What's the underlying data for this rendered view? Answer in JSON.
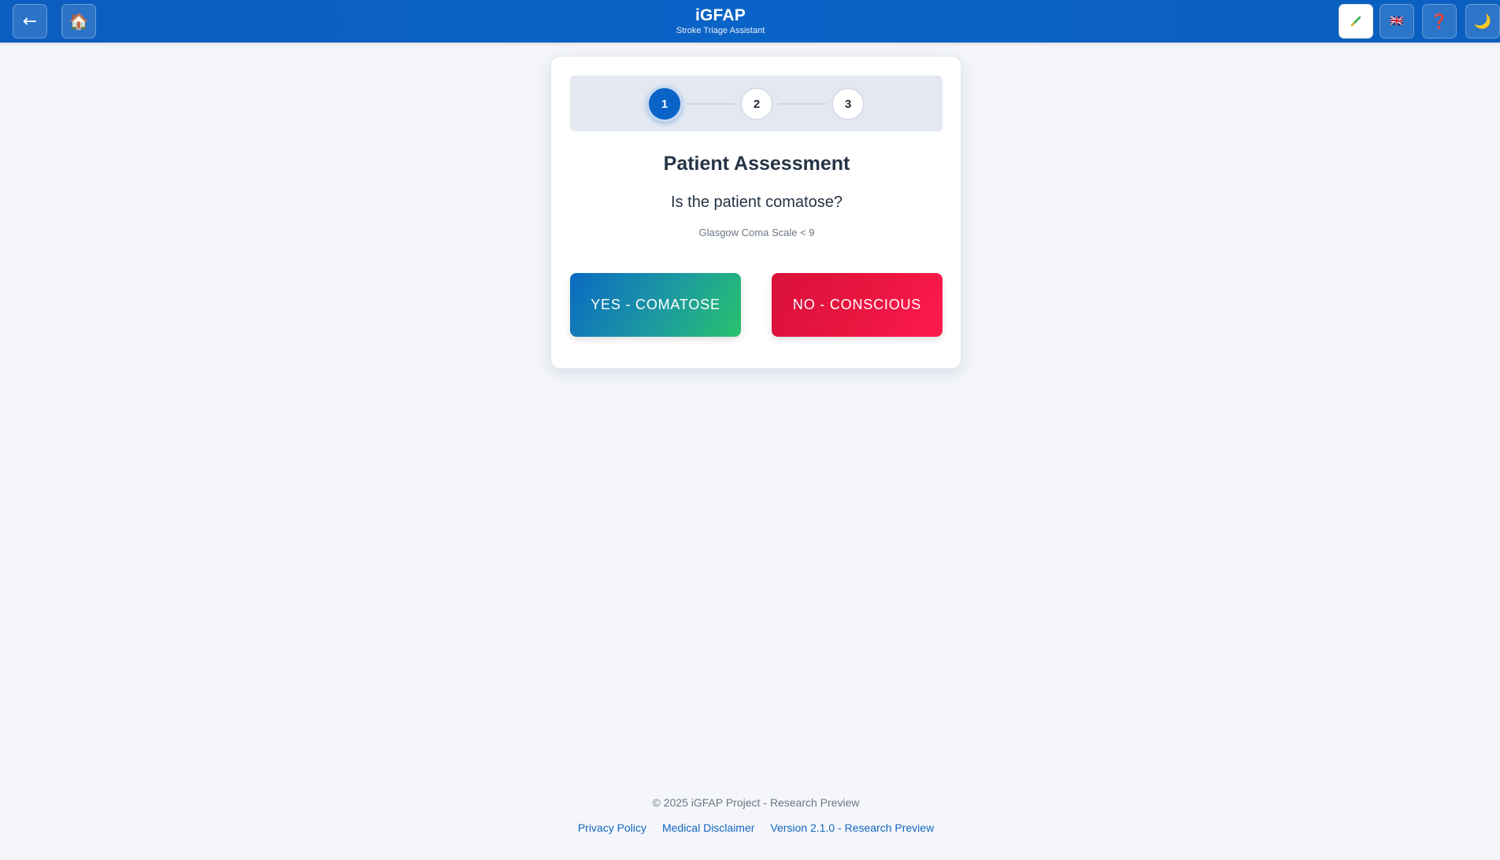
{
  "header": {
    "title": "iGFAP",
    "subtitle": "Stroke Triage Assistant",
    "back_icon": "←",
    "home_icon": "🏠",
    "theme_icon": "🖊",
    "lang_icon": "🇬🇧",
    "help_icon": "❓",
    "dark_icon": "🌙"
  },
  "stepper": {
    "steps": [
      "1",
      "2",
      "3"
    ],
    "active": 1
  },
  "assessment": {
    "heading": "Patient Assessment",
    "question": "Is the patient comatose?",
    "hint": "Glasgow Coma Scale < 9",
    "yes_label": "YES - COMATOSE",
    "no_label": "NO - CONSCIOUS"
  },
  "footer": {
    "copyright": "© 2025 iGFAP Project - Research Preview",
    "links": [
      "Privacy Policy",
      "Medical Disclaimer",
      "Version 2.1.0 - Research Preview"
    ]
  },
  "colors": {
    "header": "#0a63c6",
    "yes_button": "#1d9aa0",
    "no_button": "#e8153f",
    "link": "#1465c0"
  }
}
